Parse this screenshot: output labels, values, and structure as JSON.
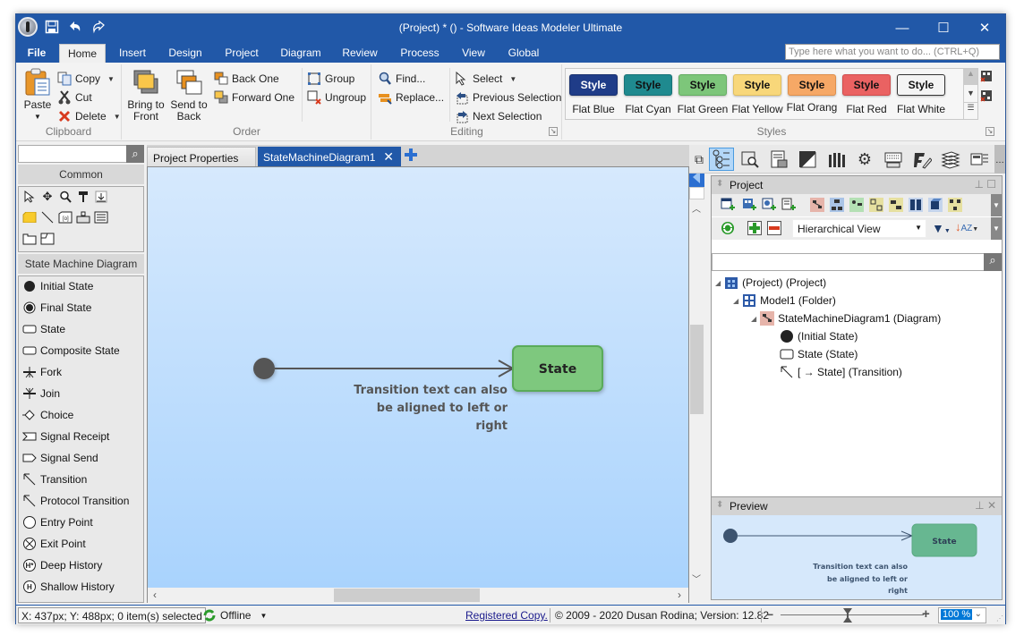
{
  "window": {
    "title": "(Project) * () - Software Ideas Modeler Ultimate",
    "controls": {
      "minimize": "—",
      "maximize": "☐",
      "close": "✕"
    }
  },
  "quick_access": [
    {
      "name": "app-logo",
      "icon": "app-logo-icon"
    },
    {
      "name": "save",
      "icon": "save-icon"
    },
    {
      "name": "undo",
      "icon": "undo-icon"
    },
    {
      "name": "redo",
      "icon": "redo-icon"
    }
  ],
  "menu": {
    "tabs": [
      "File",
      "Home",
      "Insert",
      "Design",
      "Project",
      "Diagram",
      "Review",
      "Process",
      "View",
      "Global"
    ],
    "active": "Home",
    "search_placeholder": "Type here what you want to do...  (CTRL+Q)"
  },
  "ribbon": {
    "clipboard": {
      "label": "Clipboard",
      "paste": "Paste",
      "copy": "Copy",
      "cut": "Cut",
      "delete": "Delete"
    },
    "order": {
      "label": "Order",
      "bring_to_front": [
        "Bring to",
        "Front"
      ],
      "send_to_back": [
        "Send to",
        "Back"
      ],
      "back_one": "Back One",
      "forward_one": "Forward One",
      "group": "Group",
      "ungroup": "Ungroup"
    },
    "editing": {
      "label": "Editing",
      "find": "Find...",
      "replace": "Replace...",
      "select": "Select",
      "previous_selection": "Previous Selection",
      "next_selection": "Next Selection"
    },
    "styles": {
      "label": "Styles",
      "chip_text": "Style",
      "items": [
        {
          "name": "Flat Blue",
          "bg": "#1f3c88",
          "fg": "#ffffff",
          "border": "#1a3270"
        },
        {
          "name": "Flat Cyan",
          "bg": "#1f8a8f",
          "fg": "#111111",
          "border": "#187378"
        },
        {
          "name": "Flat Green",
          "bg": "#7dc67a",
          "fg": "#111111",
          "border": "#64ad62"
        },
        {
          "name": "Flat Yellow",
          "bg": "#f8d77a",
          "fg": "#111111",
          "border": "#e0bf60"
        },
        {
          "name": "Flat Orang",
          "bg": "#f6a866",
          "fg": "#111111",
          "border": "#de8f4c"
        },
        {
          "name": "Flat Red",
          "bg": "#ea6262",
          "fg": "#111111",
          "border": "#cf4d4d"
        },
        {
          "name": "Flat White",
          "bg": "#f4f4f4",
          "fg": "#111111",
          "border": "#333333"
        }
      ]
    }
  },
  "toolbox": {
    "search_value": "",
    "common_label": "Common",
    "common_tools": [
      "pointer-icon",
      "pan-icon",
      "zoom-icon",
      "format-painter-icon",
      "insert-space-icon",
      "note-icon",
      "line-icon",
      "image-icon",
      "stamp-icon",
      "text-block-icon",
      "package-icon",
      "frame-icon"
    ],
    "section_label": "State Machine Diagram",
    "items": [
      {
        "label": "Initial State",
        "icon": "initial-state-icon"
      },
      {
        "label": "Final State",
        "icon": "final-state-icon"
      },
      {
        "label": "State",
        "icon": "state-icon"
      },
      {
        "label": "Composite State",
        "icon": "composite-state-icon"
      },
      {
        "label": "Fork",
        "icon": "fork-icon"
      },
      {
        "label": "Join",
        "icon": "join-icon"
      },
      {
        "label": "Choice",
        "icon": "choice-icon"
      },
      {
        "label": "Signal Receipt",
        "icon": "signal-receipt-icon"
      },
      {
        "label": "Signal Send",
        "icon": "signal-send-icon"
      },
      {
        "label": "Transition",
        "icon": "transition-icon"
      },
      {
        "label": "Protocol Transition",
        "icon": "protocol-transition-icon"
      },
      {
        "label": "Entry Point",
        "icon": "entry-point-icon"
      },
      {
        "label": "Exit Point",
        "icon": "exit-point-icon"
      },
      {
        "label": "Deep History",
        "icon": "deep-history-icon"
      },
      {
        "label": "Shallow History",
        "icon": "shallow-history-icon"
      }
    ]
  },
  "document_tabs": [
    {
      "label": "Project Properties",
      "active": false
    },
    {
      "label": "StateMachineDiagram1",
      "active": true
    }
  ],
  "diagram": {
    "state_label": "State",
    "transition_text": [
      "Transition text can also",
      "be aligned to left or",
      "right"
    ],
    "colors": {
      "state_fill": "#7ec87e",
      "state_border": "#5aab5a",
      "initial": "#555555",
      "line": "#555555",
      "text": "#555555"
    }
  },
  "project_panel": {
    "title": "Project",
    "view_mode": "Hierarchical View",
    "search_value": "",
    "tree": [
      {
        "label": "(Project) (Project)",
        "level": 0,
        "icon": "project-icon",
        "expanded": true
      },
      {
        "label": "Model1 (Folder)",
        "level": 1,
        "icon": "folder-model-icon",
        "expanded": true
      },
      {
        "label": "StateMachineDiagram1 (Diagram)",
        "level": 2,
        "icon": "state-diagram-icon",
        "expanded": true
      },
      {
        "label": "(Initial State)",
        "level": 3,
        "icon": "initial-state-icon"
      },
      {
        "label": "State (State)",
        "level": 3,
        "icon": "state-icon"
      },
      {
        "label": "[ → State] (Transition)",
        "level": 3,
        "icon": "transition-icon"
      }
    ]
  },
  "preview_panel": {
    "title": "Preview",
    "state_label": "State",
    "transition_text": [
      "Transition text can also",
      "be aligned to left or",
      "right"
    ]
  },
  "statusbar": {
    "coords": "X: 437px; Y: 488px; 0 item(s) selected",
    "connection": "Offline",
    "registered": "Registered Copy.",
    "copyright": "© 2009 - 2020 Dusan Rodina; Version: 12.82",
    "zoom_percent": 100,
    "zoom_text": "100 %"
  }
}
